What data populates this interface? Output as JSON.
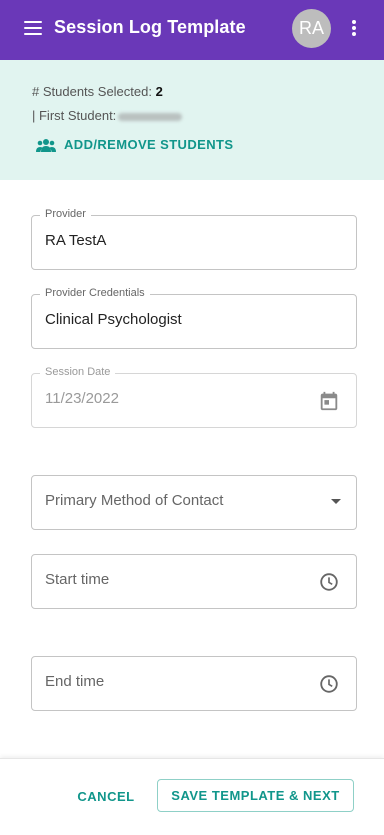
{
  "app_bar": {
    "title": "Session Log Template",
    "avatar_initials": "RA",
    "menu_icon": "hamburger-menu-icon",
    "more_icon": "more-vertical-icon",
    "background_color": "#6a38b8"
  },
  "students": {
    "selected_label": "# Students Selected: ",
    "selected_count": "2",
    "first_student_label": "| First Student:",
    "add_remove_label": "ADD/REMOVE STUDENTS",
    "icon": "people-icon",
    "accent_color": "#11968b"
  },
  "form": {
    "provider": {
      "label": "Provider",
      "value": "RA TestA"
    },
    "provider_credentials": {
      "label": "Provider Credentials",
      "value": "Clinical Psychologist"
    },
    "session_date": {
      "label": "Session Date",
      "value": "11/23/2022",
      "icon": "calendar-icon"
    },
    "primary_method": {
      "placeholder": "Primary Method of Contact",
      "icon": "dropdown-arrow-icon"
    },
    "start_time": {
      "placeholder": "Start time",
      "icon": "clock-icon"
    },
    "end_time": {
      "placeholder": "End time",
      "icon": "clock-icon"
    }
  },
  "footer": {
    "cancel_label": "CANCEL",
    "save_label": "SAVE TEMPLATE & NEXT"
  }
}
